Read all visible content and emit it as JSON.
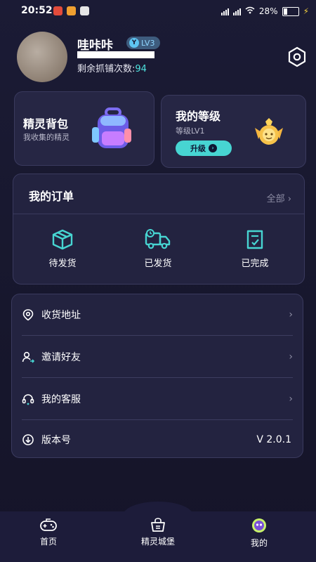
{
  "status_bar": {
    "time": "20:52",
    "battery": "28%"
  },
  "profile": {
    "nickname": "哇咔咔",
    "level_badge": "LV3",
    "remaining_label": "剩余抓铺次数:",
    "remaining_count": "94"
  },
  "backpack_card": {
    "title": "精灵背包",
    "subtitle": "我收集的精灵"
  },
  "level_card": {
    "title": "我的等级",
    "subtitle": "等级LV1",
    "upgrade_label": "升级"
  },
  "orders": {
    "title": "我的订单",
    "all_label": "全部",
    "statuses": [
      {
        "label": "待发货"
      },
      {
        "label": "已发货"
      },
      {
        "label": "已完成"
      }
    ]
  },
  "menu": [
    {
      "label": "收货地址"
    },
    {
      "label": "邀请好友"
    },
    {
      "label": "我的客服"
    },
    {
      "label": "版本号",
      "value": "V 2.0.1"
    }
  ],
  "tabs": [
    {
      "label": "首页"
    },
    {
      "label": "精灵城堡"
    },
    {
      "label": "我的"
    }
  ],
  "colors": {
    "accent": "#47d5d2",
    "background": "#1b1b35",
    "card": "#262644"
  }
}
